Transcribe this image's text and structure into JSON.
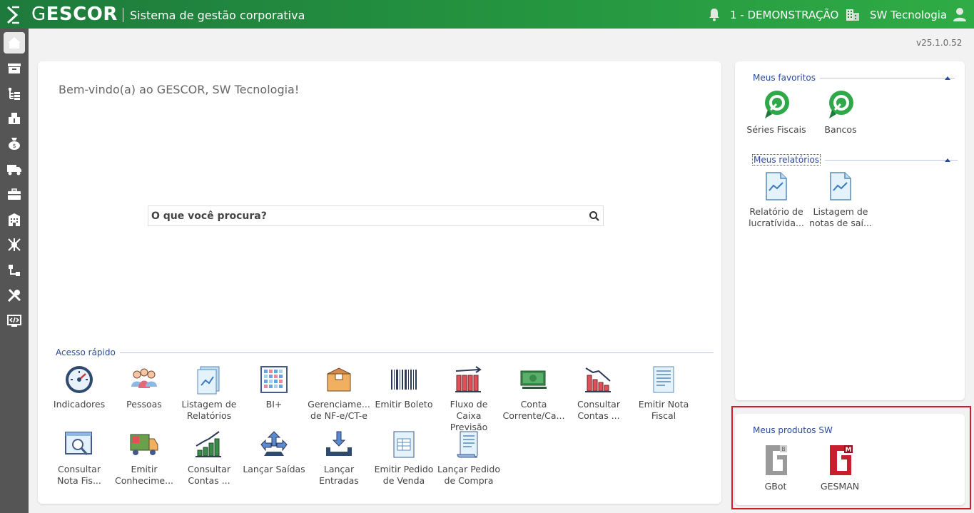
{
  "header": {
    "brand_g": "G",
    "brand_rest": "ESCOR",
    "subtitle": "Sistema de gestão corporativa",
    "company": "1 - DEMONSTRAÇÃO",
    "user_name": "SW Tecnologia"
  },
  "version": "v25.1.0.52",
  "main": {
    "welcome": "Bem-vindo(a) ao GESCOR, SW Tecnologia!",
    "search_placeholder": "O que você procura?",
    "quick_access_title": "Acesso rápido",
    "quick_items": [
      {
        "label": "Indicadores",
        "icon": "speedometer-icon"
      },
      {
        "label": "Pessoas",
        "icon": "people-icon"
      },
      {
        "label": "Listagem de Relatórios",
        "icon": "report-list-icon"
      },
      {
        "label": "BI+",
        "icon": "bi-grid-icon"
      },
      {
        "label": "Gerenciame... de NF-e/CT-e",
        "icon": "box-icon"
      },
      {
        "label": "Emitir Boleto",
        "icon": "barcode-icon"
      },
      {
        "label": "Fluxo de Caixa Previsão",
        "icon": "cashflow-chart-icon"
      },
      {
        "label": "Conta Corrente/Ca...",
        "icon": "money-icon"
      },
      {
        "label": "Consultar Contas ...",
        "icon": "down-chart-icon"
      },
      {
        "label": "Emitir Nota Fiscal",
        "icon": "invoice-icon"
      },
      {
        "label": "Consultar Nota Fis...",
        "icon": "search-window-icon"
      },
      {
        "label": "Emitir Conhecime...",
        "icon": "truck-icon"
      },
      {
        "label": "Consultar Contas ...",
        "icon": "up-chart-icon"
      },
      {
        "label": "Lançar Saídas",
        "icon": "outgoing-arrows-icon"
      },
      {
        "label": "Lançar Entradas",
        "icon": "incoming-arrows-icon"
      },
      {
        "label": "Emitir Pedido de Venda",
        "icon": "sales-order-icon"
      },
      {
        "label": "Lançar Pedido de Compra",
        "icon": "purchase-order-icon"
      }
    ]
  },
  "favorites": {
    "title": "Meus favoritos",
    "items": [
      {
        "label": "Séries Fiscais",
        "icon": "green-badge-icon"
      },
      {
        "label": "Bancos",
        "icon": "green-badge-icon"
      }
    ]
  },
  "reports": {
    "title": "Meus relatórios",
    "items": [
      {
        "label": "Relatório de lucratívida...",
        "icon": "report-file-icon"
      },
      {
        "label": "Listagem de notas de saí...",
        "icon": "report-file-icon"
      }
    ]
  },
  "products": {
    "title": "Meus produtos SW",
    "items": [
      {
        "label": "GBot",
        "icon": "gbot-logo-icon"
      },
      {
        "label": "GESMAN",
        "icon": "gesman-logo-icon"
      }
    ]
  },
  "colors": {
    "header_start": "#1e7a3c",
    "header_end": "#2fac45",
    "sidebar": "#555555",
    "section_title": "#2b4a9a",
    "highlight_border": "#d11a2a"
  }
}
